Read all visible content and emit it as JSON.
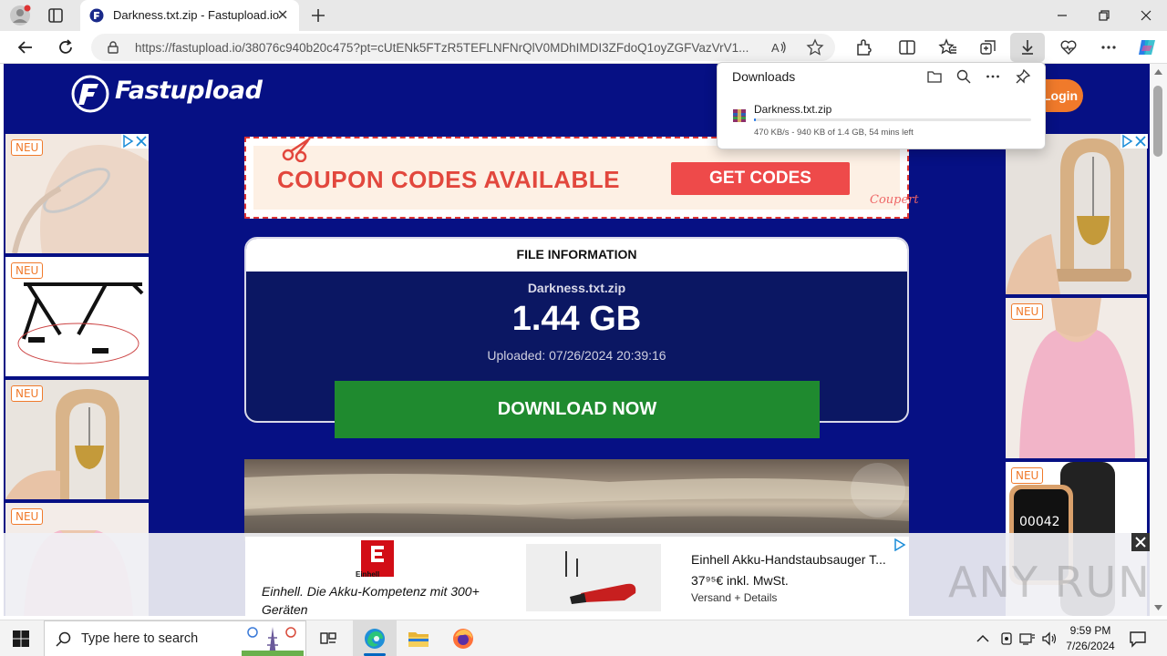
{
  "browser": {
    "tab_title": "Darkness.txt.zip - Fastupload.io",
    "url": "https://fastupload.io/38076c940b20c475?pt=cUtENk5FTzR5TEFLNFNrQlV0MDhIMDI3ZFdoQ1oyZGFVazVrV1..."
  },
  "site": {
    "logo_text": "Fastupload",
    "login_label": "Login",
    "coupon": {
      "headline": "COUPON CODES AVAILABLE",
      "button": "GET CODES",
      "brand": "Coupert"
    },
    "file_info": {
      "header": "FILE INFORMATION",
      "filename": "Darkness.txt.zip",
      "size": "1.44 GB",
      "uploaded": "Uploaded: 07/26/2024 20:39:16"
    },
    "download_button": "DOWNLOAD NOW",
    "badge_new": "NEU",
    "bottom_ad": {
      "brand": "Einhell",
      "slogan": "Einhell. Die Akku-Kompetenz mit 300+ Geräten",
      "product_title": "Einhell Akku-Handstaubsauger T...",
      "price": "37⁹⁵€ inkl. MwSt.",
      "shipping": "Versand + Details"
    }
  },
  "downloads_panel": {
    "title": "Downloads",
    "item_name": "Darkness.txt.zip",
    "status": "470 KB/s - 940 KB of 1.4 GB, 54 mins left",
    "progress_fraction": 0.0007
  },
  "watermark": "ANY RUN",
  "taskbar": {
    "search_placeholder": "Type here to search",
    "time": "9:59 PM",
    "date": "7/26/2024"
  },
  "colors": {
    "page_bg": "#061084",
    "download_green": "#1f8a2f",
    "accent_orange": "#f07a2b",
    "coupon_red": "#e2473d"
  }
}
